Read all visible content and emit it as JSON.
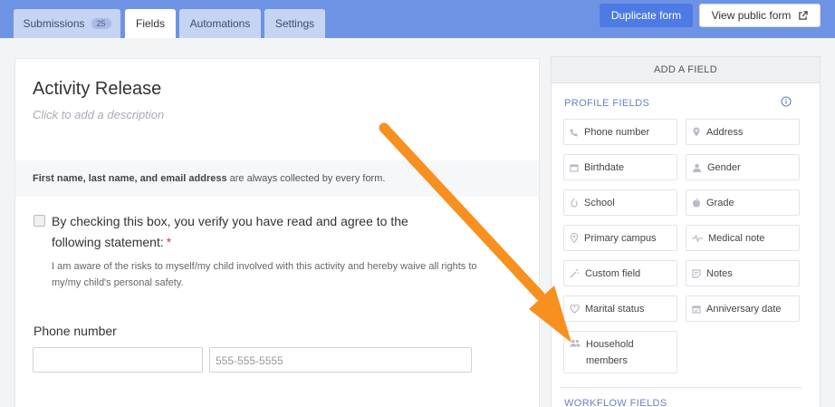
{
  "tabs": {
    "submissions": {
      "label": "Submissions",
      "badge": "25"
    },
    "fields": {
      "label": "Fields"
    },
    "automations": {
      "label": "Automations"
    },
    "settings": {
      "label": "Settings"
    }
  },
  "header": {
    "duplicate_label": "Duplicate form",
    "view_public_label": "View public form"
  },
  "form": {
    "title": "Activity Release",
    "description_placeholder": "Click to add a description",
    "collected_notice_bold": "First name, last name, and email address",
    "collected_notice_rest": " are always collected by every form.",
    "checkbox_label": "By checking this box, you verify you have read and agree to the following statement:",
    "required_mark": "*",
    "statement": "I am aware of the risks to myself/my child involved with this activity and hereby waive all rights to my/my child's personal safety.",
    "phone_label": "Phone number",
    "phone_placeholder": "555-555-5555"
  },
  "sidebar": {
    "header": "ADD A FIELD",
    "profile_section": "PROFILE FIELDS",
    "workflow_section": "WORKFLOW FIELDS",
    "profile_fields": [
      {
        "label": "Phone number",
        "icon": "phone-icon"
      },
      {
        "label": "Address",
        "icon": "location-pin-icon"
      },
      {
        "label": "Birthdate",
        "icon": "calendar-icon"
      },
      {
        "label": "Gender",
        "icon": "person-icon"
      },
      {
        "label": "School",
        "icon": "school-icon"
      },
      {
        "label": "Grade",
        "icon": "apple-icon"
      },
      {
        "label": "Primary campus",
        "icon": "location-pin-icon"
      },
      {
        "label": "Medical note",
        "icon": "heartbeat-icon"
      },
      {
        "label": "Custom field",
        "icon": "magic-wand-icon"
      },
      {
        "label": "Notes",
        "icon": "note-icon"
      },
      {
        "label": "Marital status",
        "icon": "heart-icon"
      },
      {
        "label": "Anniversary date",
        "icon": "calendar-check-icon"
      },
      {
        "label": "Household members",
        "icon": "people-icon"
      }
    ]
  },
  "colors": {
    "topbar": "#6f93e4",
    "primary_button": "#4d7ae4",
    "section_label": "#6a82c0",
    "required": "#d8344a",
    "arrow": "#f7901e"
  }
}
